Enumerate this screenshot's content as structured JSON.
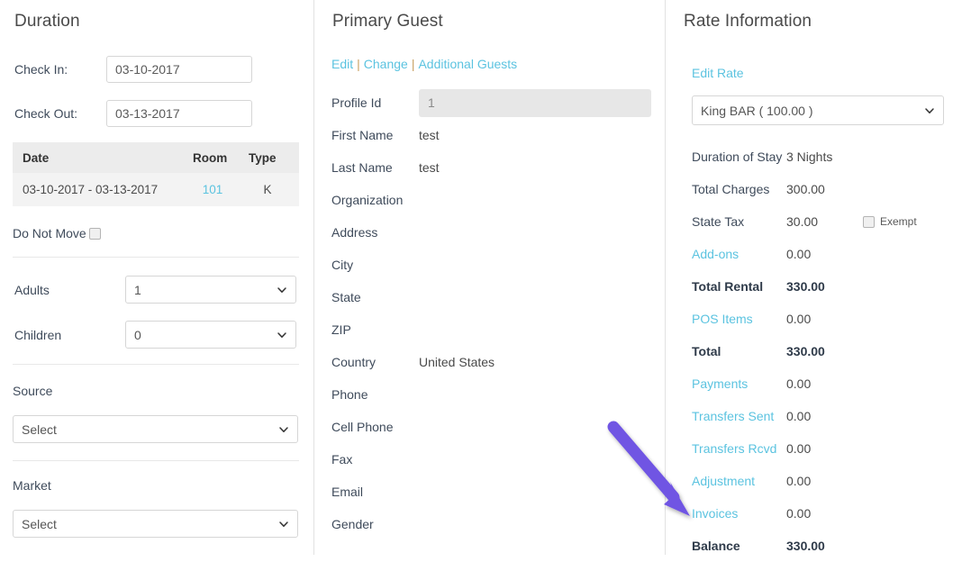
{
  "duration": {
    "title": "Duration",
    "check_in_label": "Check In:",
    "check_in_value": "03-10-2017",
    "check_out_label": "Check Out:",
    "check_out_value": "03-13-2017",
    "table": {
      "headers": [
        "Date",
        "Room",
        "Type"
      ],
      "rows": [
        {
          "date": "03-10-2017 - 03-13-2017",
          "room": "101",
          "type": "K"
        }
      ]
    },
    "do_not_move_label": "Do Not Move",
    "adults_label": "Adults",
    "adults_value": "1",
    "children_label": "Children",
    "children_value": "0",
    "source_label": "Source",
    "source_value": "Select",
    "market_label": "Market",
    "market_value": "Select"
  },
  "primary_guest": {
    "title": "Primary Guest",
    "links": {
      "edit": "Edit",
      "separator": "|",
      "change": "Change",
      "additional_guests": "Additional Guests"
    },
    "profile_id_label": "Profile Id",
    "profile_id_value": "1",
    "fields": [
      {
        "label": "First Name",
        "value": "test"
      },
      {
        "label": "Last Name",
        "value": "test"
      },
      {
        "label": "Organization",
        "value": ""
      },
      {
        "label": "Address",
        "value": ""
      },
      {
        "label": "City",
        "value": ""
      },
      {
        "label": "State",
        "value": ""
      },
      {
        "label": "ZIP",
        "value": ""
      },
      {
        "label": "Country",
        "value": "United States"
      },
      {
        "label": "Phone",
        "value": ""
      },
      {
        "label": "Cell Phone",
        "value": ""
      },
      {
        "label": "Fax",
        "value": ""
      },
      {
        "label": "Email",
        "value": ""
      },
      {
        "label": "Gender",
        "value": ""
      }
    ]
  },
  "rate_information": {
    "title": "Rate Information",
    "edit_rate_label": "Edit Rate",
    "rate_select_value": "King BAR ( 100.00 )",
    "exempt_label": "Exempt",
    "rows": [
      {
        "label": "Duration of Stay",
        "value": "3 Nights",
        "link": false,
        "bold": false,
        "exempt": false
      },
      {
        "label": "Total Charges",
        "value": "300.00",
        "link": false,
        "bold": false,
        "exempt": false
      },
      {
        "label": "State Tax",
        "value": "30.00",
        "link": false,
        "bold": false,
        "exempt": true
      },
      {
        "label": "Add-ons",
        "value": "0.00",
        "link": true,
        "bold": false,
        "exempt": false
      },
      {
        "label": "Total Rental",
        "value": "330.00",
        "link": false,
        "bold": true,
        "exempt": false
      },
      {
        "label": "POS Items",
        "value": "0.00",
        "link": true,
        "bold": false,
        "exempt": false
      },
      {
        "label": "Total",
        "value": "330.00",
        "link": false,
        "bold": true,
        "exempt": false
      },
      {
        "label": "Payments",
        "value": "0.00",
        "link": true,
        "bold": false,
        "exempt": false
      },
      {
        "label": "Transfers Sent",
        "value": "0.00",
        "link": true,
        "bold": false,
        "exempt": false
      },
      {
        "label": "Transfers Rcvd",
        "value": "0.00",
        "link": true,
        "bold": false,
        "exempt": false
      },
      {
        "label": "Adjustment",
        "value": "0.00",
        "link": true,
        "bold": false,
        "exempt": false
      },
      {
        "label": "Invoices",
        "value": "0.00",
        "link": true,
        "bold": false,
        "exempt": false
      },
      {
        "label": "Balance",
        "value": "330.00",
        "link": false,
        "bold": true,
        "exempt": false
      }
    ]
  },
  "annotation": {
    "arrow_color": "#6f54e3",
    "points_to": "Invoices"
  },
  "colors": {
    "link": "#5bc3e0",
    "text": "#3f4b5b",
    "table_header_bg": "#ececec",
    "table_row_bg": "#f3f3f3",
    "readonly_bg": "#e7e7e7",
    "divider": "#e2e2e2"
  }
}
